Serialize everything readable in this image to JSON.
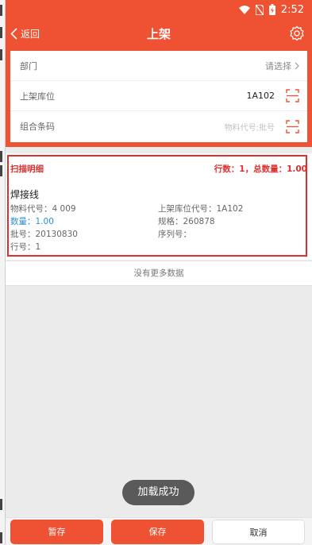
{
  "status_bar": {
    "time": "2:52"
  },
  "header": {
    "back_label": "返回",
    "title": "上架"
  },
  "form": {
    "department": {
      "label": "部门",
      "value": "请选择"
    },
    "location": {
      "label": "上架库位",
      "value": "1A102"
    },
    "combo_barcode": {
      "label": "组合条码",
      "placeholder": "物料代号;批号"
    }
  },
  "scan_detail": {
    "heading": "扫描明细",
    "summary": "行数：1，总数量：1.00",
    "item": {
      "name": "焊接线",
      "material_code": "物料代号：4   009",
      "location_code": "上架库位代号：1A102",
      "quantity": "数量：1.00",
      "spec": "规格：260878",
      "batch": "批号：20130830",
      "serial": "序列号：",
      "row_no": "行号：1"
    }
  },
  "list_footer": "没有更多数据",
  "toast": "加载成功",
  "actions": {
    "pause": "暂存",
    "save": "保存",
    "cancel": "取消"
  },
  "colors": {
    "accent": "#ef5232",
    "highlight_border": "#e0302e",
    "quantity_blue": "#2b8ed6"
  }
}
